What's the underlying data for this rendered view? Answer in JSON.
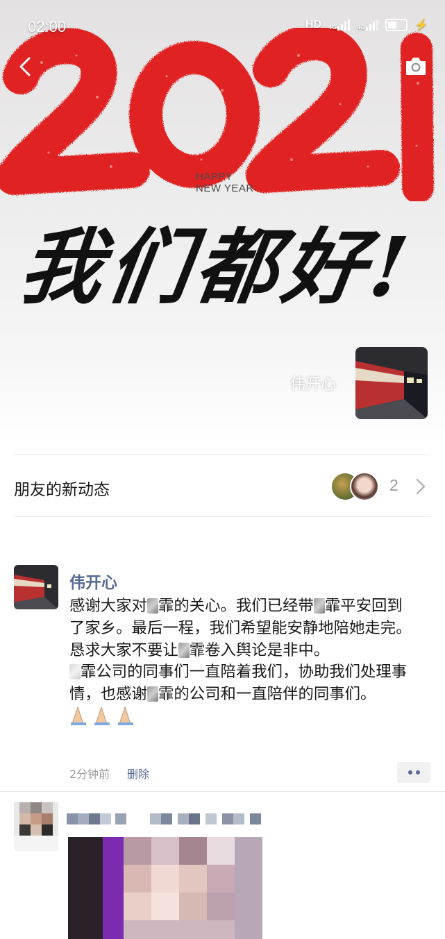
{
  "status_bar": {
    "time": "02:00",
    "network": "HD",
    "signal_a": "4G",
    "signal_b": "4G"
  },
  "cover": {
    "year": "2021",
    "happy_line1": "HAPPY",
    "happy_line2": "NEW YEAR",
    "slogan": "我们都好!",
    "owner_name": "伟开心",
    "year_color": "#e02020"
  },
  "friends_row": {
    "label": "朋友的新动态",
    "count": "2"
  },
  "post": {
    "author": "伟开心",
    "paragraph1": {
      "a": "感谢大家对",
      "b": "霏的关心。我们已经带",
      "c": "霏平安回到了家乡。最后一程，我们希望能安静地陪她走完。恳求大家不要让",
      "d": "霏卷入舆论是非中。"
    },
    "paragraph2": {
      "a": "霏公司的同事们一直陪着我们，协助我们处理事情，也感谢",
      "b": "霏的公司和一直陪伴的同事们。"
    },
    "time": "2分钟前",
    "delete_label": "删除",
    "link_color": "#576b95"
  },
  "icons": {
    "back": "chevron-left-icon",
    "camera": "camera-icon",
    "more": "more-dots-icon",
    "arrow": "chevron-right-icon",
    "emoji": "folded-hands-emoji"
  }
}
